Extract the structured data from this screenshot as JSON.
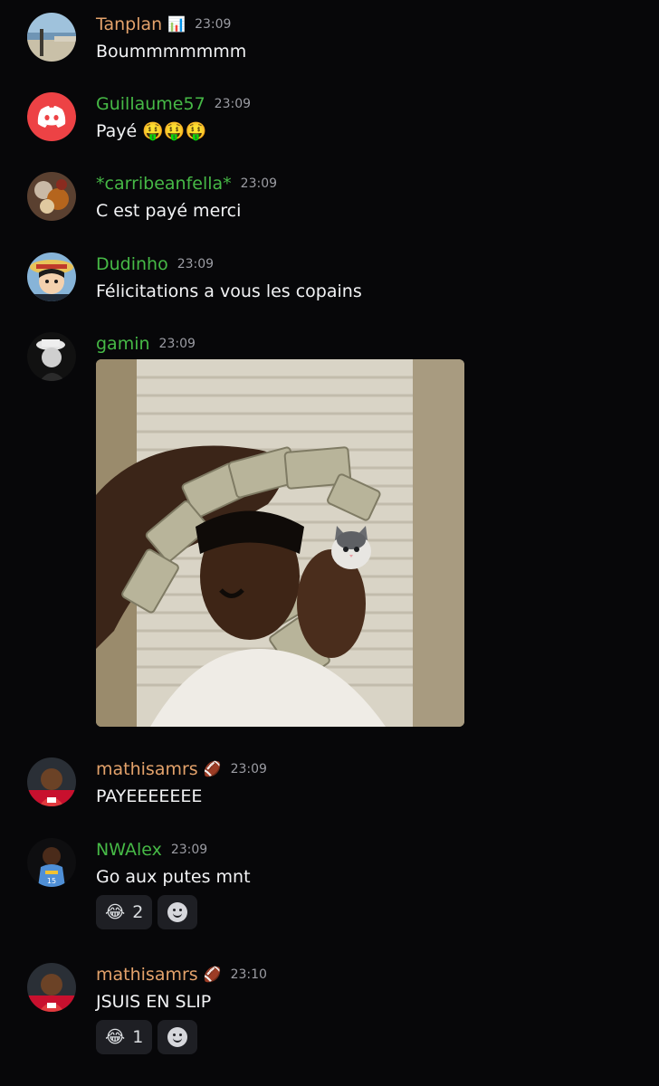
{
  "messages": [
    {
      "username": "Tanplan",
      "badge": "📊",
      "time": "23:09",
      "text": "Boummmmmmm",
      "color": "#e3a26b"
    },
    {
      "username": "Guillaume57",
      "time": "23:09",
      "text": "Payé 🤑🤑🤑",
      "color": "#46b946"
    },
    {
      "username": "*carribeanfella*",
      "time": "23:09",
      "text": "C est payé merci",
      "color": "#46b946"
    },
    {
      "username": "Dudinho",
      "time": "23:09",
      "text": "Félicitations a vous les copains",
      "color": "#46b946"
    },
    {
      "username": "gamin",
      "time": "23:09",
      "attachment": "gif-money-phone",
      "color": "#46b946"
    },
    {
      "username": "mathisamrs",
      "badge": "🏈",
      "time": "23:09",
      "text": "PAYEEEEEEE",
      "color": "#e3a26b"
    },
    {
      "username": "NWAlex",
      "time": "23:09",
      "text": "Go aux putes mnt",
      "color": "#46b946",
      "reactions": [
        {
          "emoji": "😂",
          "count": "2"
        }
      ]
    },
    {
      "username": "mathisamrs",
      "badge": "🏈",
      "time": "23:10",
      "text": "JSUIS EN SLIP",
      "color": "#e3a26b",
      "reactions": [
        {
          "emoji": "😂",
          "count": "1"
        }
      ]
    }
  ],
  "icons": {
    "add_reaction": "smiley-add-icon",
    "discord_logo": "discord-logo-icon"
  }
}
